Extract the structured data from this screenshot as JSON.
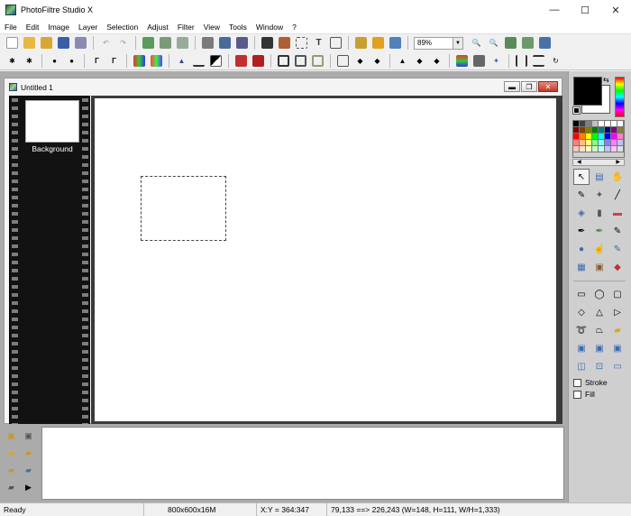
{
  "app": {
    "title": "PhotoFiltre Studio X"
  },
  "window_controls": {
    "minimize": "—",
    "maximize": "☐",
    "close": "✕"
  },
  "menu": [
    "File",
    "Edit",
    "Image",
    "Layer",
    "Selection",
    "Adjust",
    "Filter",
    "View",
    "Tools",
    "Window",
    "?"
  ],
  "toolbar": {
    "zoom_value": "89%"
  },
  "document": {
    "title": "Untitled 1",
    "layer_name": "Background"
  },
  "right_panel": {
    "stroke_label": "Stroke",
    "fill_label": "Fill"
  },
  "status": {
    "state": "Ready",
    "image_info": "800x600x16M",
    "cursor": "X:Y = 364:347",
    "selection": "79,133 ==> 226,243 (W=148, H=111, W/H=1,333)"
  },
  "palette": [
    "#000000",
    "#404040",
    "#808080",
    "#c0c0c0",
    "#ffffff",
    "#ffffff",
    "#ffffff",
    "#ffffff",
    "#800000",
    "#804000",
    "#808000",
    "#008000",
    "#008080",
    "#000080",
    "#800080",
    "#808040",
    "#ff0000",
    "#ff8000",
    "#ffff00",
    "#00ff00",
    "#00ffff",
    "#0000ff",
    "#ff00ff",
    "#ff80c0",
    "#ff8080",
    "#ffc080",
    "#ffff80",
    "#80ff80",
    "#80ffff",
    "#8080ff",
    "#ff80ff",
    "#c0c0ff",
    "#ffc0c0",
    "#ffe0c0",
    "#ffffc0",
    "#c0ffc0",
    "#c0ffff",
    "#c0c0ff",
    "#ffc0ff",
    "#e0e0e0"
  ]
}
